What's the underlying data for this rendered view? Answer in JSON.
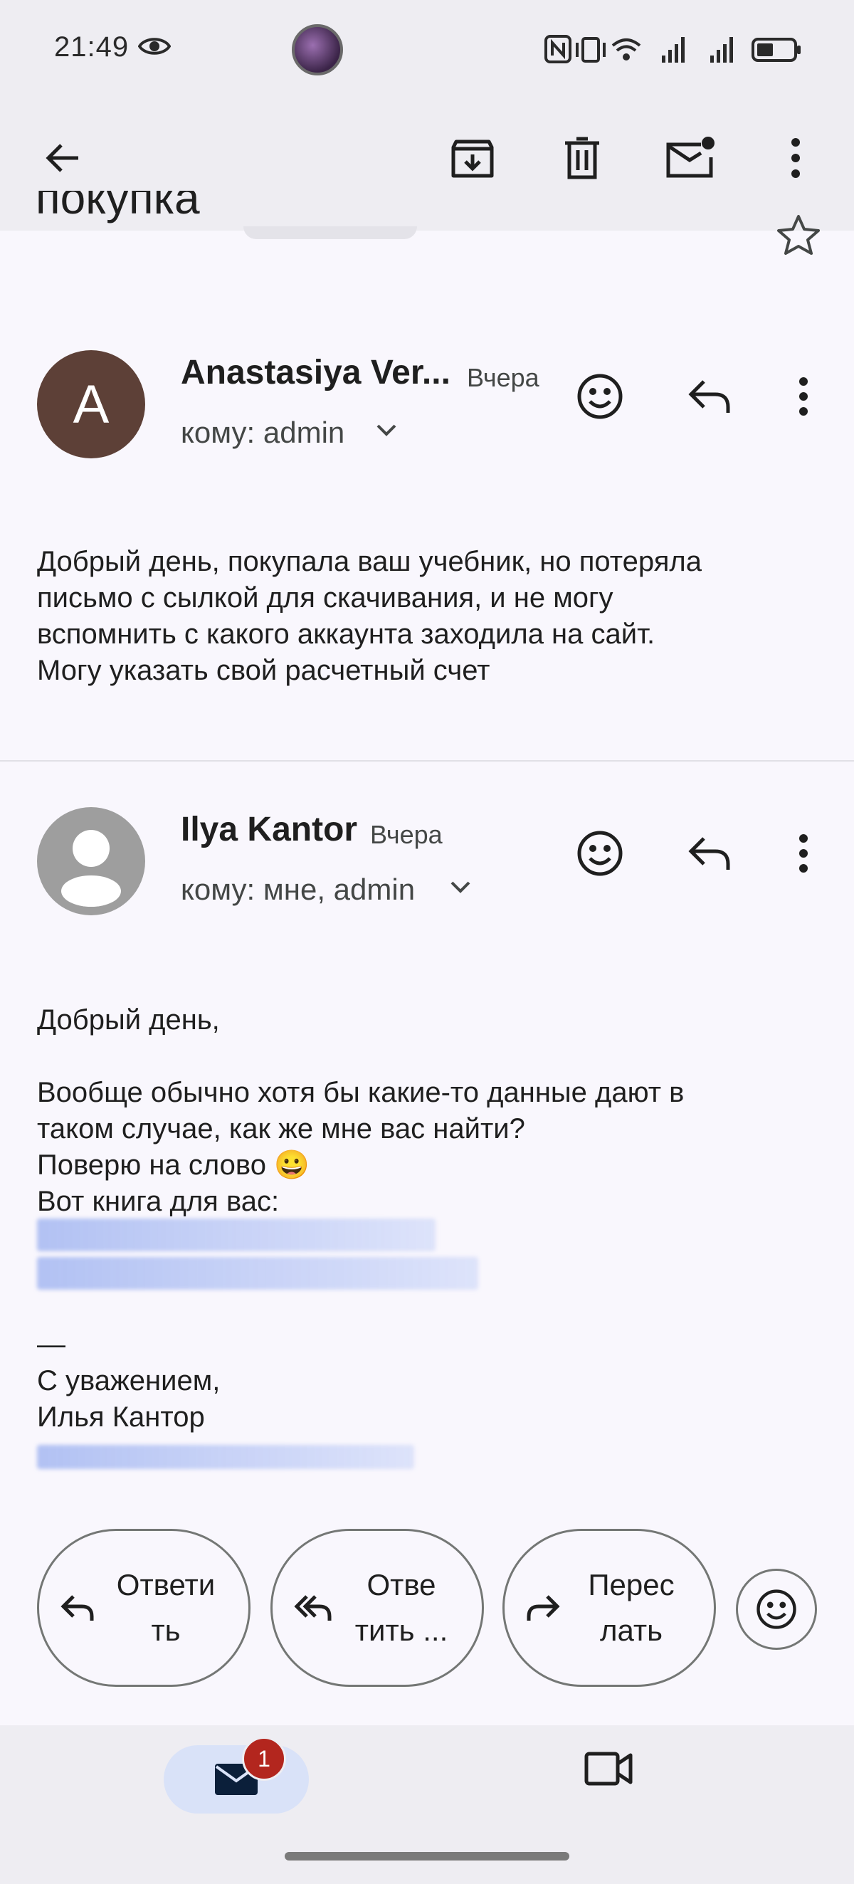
{
  "status_bar": {
    "time": "21:49",
    "icons": [
      "eye-icon",
      "nfc-icon",
      "vibrate-icon",
      "wifi-icon",
      "signal-icon",
      "signal-icon",
      "battery-icon"
    ]
  },
  "toolbar": {
    "icons": [
      "back-arrow-icon",
      "archive-icon",
      "trash-icon",
      "mark-unread-icon",
      "more-vert-icon"
    ]
  },
  "thread": {
    "subject": "покупка"
  },
  "messages": [
    {
      "avatar_letter": "A",
      "avatar_color": "#5d4037",
      "sender": "Anastasiya Ver...",
      "time": "Вчера",
      "to": "кому: admin",
      "body": "Добрый день, покупала ваш учебник, но потеряла\nписьмо с сылкой для скачивания, и не могу\nвспомнить с какого аккаунта заходила на сайт.\nМогу указать свой расчетный счет"
    },
    {
      "avatar_color": "#9e9e9e",
      "sender": "Ilya Kantor",
      "time": "Вчера",
      "to": "кому: мне, admin",
      "body_1": "Добрый день,\n\nВообще обычно хотя бы какие-то данные дают в\nтаком случае, как же мне вас найти?\nПоверю на слово 😀\nВот книга для вас:",
      "signature": "—\nС уважением,\nИлья Кантор"
    }
  ],
  "actions": {
    "reply": "Ответи\nть",
    "reply_all": "Отве\nтить ...",
    "forward": "Перес\nлать"
  },
  "bottom_nav": {
    "mail_badge": "1",
    "icons": [
      "mail-icon",
      "video-icon"
    ]
  },
  "colors": {
    "background": "#f9f7fd",
    "chrome": "#eeedf2",
    "badge": "#b3261e",
    "active_nav": "#d9e2f8"
  }
}
